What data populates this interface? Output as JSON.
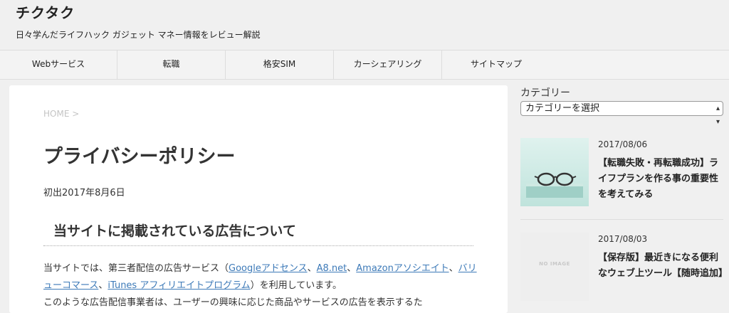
{
  "site": {
    "title": "チクタク",
    "description": "日々学んだライフハック ガジェット マネー情報をレビュー解説"
  },
  "nav": {
    "items": [
      {
        "label": "Webサービス"
      },
      {
        "label": "転職"
      },
      {
        "label": "格安SIM"
      },
      {
        "label": "カーシェアリング"
      },
      {
        "label": "サイトマップ"
      }
    ]
  },
  "main": {
    "breadcrumb": "HOME >",
    "title": "プライバシーポリシー",
    "first_published": "初出2017年8月6日",
    "section_heading": "当サイトに掲載されている広告について",
    "para1_prefix": "当サイトでは、第三者配信の広告サービス（",
    "link_google": "Googleアドセンス",
    "sep1": "、",
    "link_a8": "A8.net",
    "sep2": "、",
    "link_amazon": "Amazonアソシエイト",
    "sep3": "、",
    "link_value": "バリューコマース",
    "sep4": "、",
    "link_itunes": "iTunes アフィリエイトプログラム",
    "para1_suffix": "）を利用しています。",
    "para2": "このような広告配信事業者は、ユーザーの興味に応じた商品やサービスの広告を表示するた"
  },
  "sidebar": {
    "category_label": "カテゴリー",
    "category_select": "カテゴリーを選択",
    "posts": [
      {
        "date": "2017/08/06",
        "title": "【転職失敗・再転職成功】ライフプランを作る事の重要性を考えてみる",
        "thumb": "glasses-photo"
      },
      {
        "date": "2017/08/03",
        "title": "【保存版】最近きになる便利なウェブ上ツール【随時追加】",
        "thumb_text": "NO IMAGE"
      }
    ]
  },
  "colors": {
    "link": "#3d7ab8",
    "background": "#f0f0f0",
    "card": "#ffffff"
  }
}
